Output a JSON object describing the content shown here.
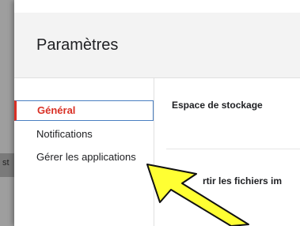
{
  "backdrop": {
    "text": "st"
  },
  "dialog": {
    "title": "Paramètres",
    "nav": [
      {
        "label": "Général",
        "active": true
      },
      {
        "label": "Notifications",
        "active": false
      },
      {
        "label": "Gérer les applications",
        "active": false
      }
    ],
    "sections": [
      {
        "label": "Espace de stockage"
      },
      {
        "label": "rtir les fichiers im"
      }
    ]
  },
  "colors": {
    "accent": "#d93025",
    "focus_border": "#4a7fc1",
    "arrow_fill": "#ffff33"
  },
  "annotation": {
    "icon": "yellow-pointer-arrow-icon"
  }
}
